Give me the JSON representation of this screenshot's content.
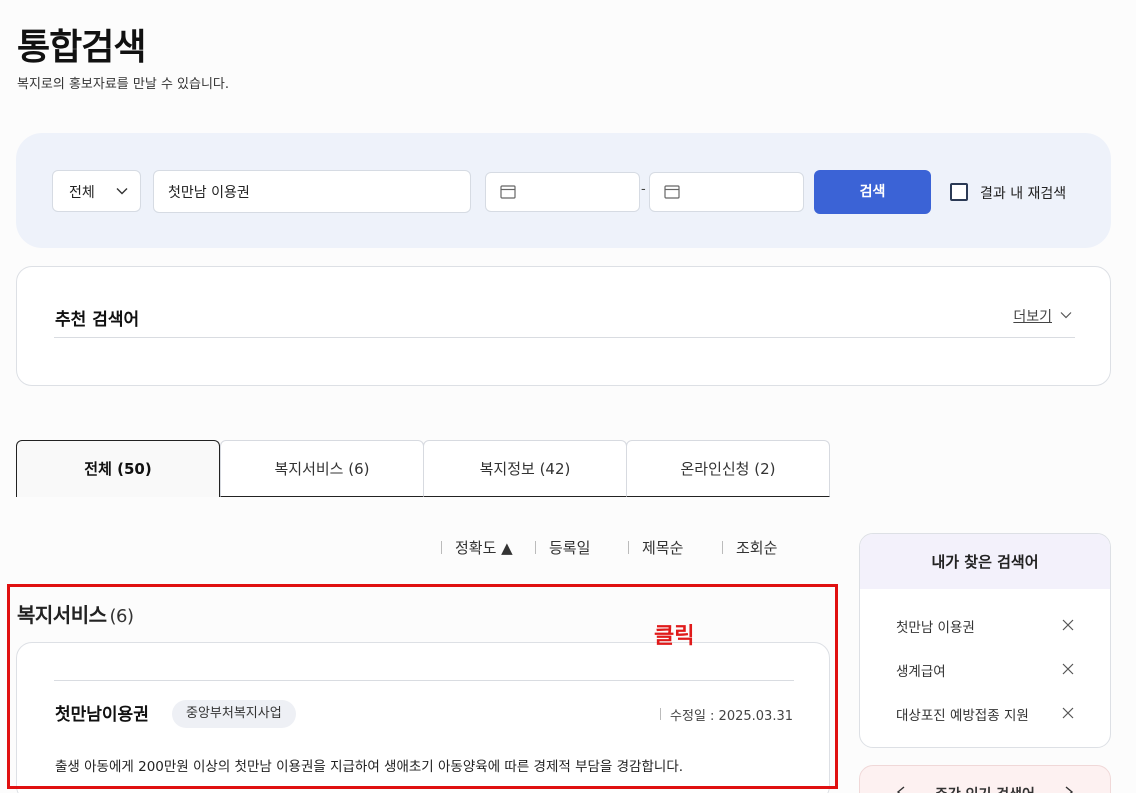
{
  "header": {
    "title": "통합검색",
    "subtitle": "복지로의 홍보자료를 만날 수 있습니다."
  },
  "search": {
    "category_value": "전체",
    "query_value": "첫만남 이용권",
    "date_separator": "-",
    "search_button": "검색",
    "research_label": "결과 내 재검색",
    "button_color": "#3b63d6"
  },
  "recommend": {
    "title": "추천 검색어",
    "more_label": "더보기"
  },
  "tabs": [
    {
      "label": "전체 (50)",
      "active": true
    },
    {
      "label": "복지서비스 (6)",
      "active": false
    },
    {
      "label": "복지정보 (42)",
      "active": false
    },
    {
      "label": "온라인신청 (2)",
      "active": false
    }
  ],
  "sort": [
    {
      "label": "정확도 ▲"
    },
    {
      "label": "등록일"
    },
    {
      "label": "제목순"
    },
    {
      "label": "조회순"
    }
  ],
  "results": {
    "section_title": "복지서비스",
    "section_count": "(6)",
    "annotation": "클릭",
    "annotation_color": "#e01010",
    "card": {
      "title": "첫만남이용권",
      "badge": "중앙부처복지사업",
      "date": "수정일 : 2025.03.31",
      "description": "출생 아동에게 200만원 이상의 첫만남 이용권을 지급하여 생애초기 아동양육에 따른 경제적 부담을 경감합니다."
    }
  },
  "history": {
    "title": "내가 찾은 검색어",
    "items": [
      "첫만남 이용권",
      "생계급여",
      "대상포진 예방접종 지원"
    ]
  },
  "popular": {
    "title": "주간 인기 검색어"
  }
}
